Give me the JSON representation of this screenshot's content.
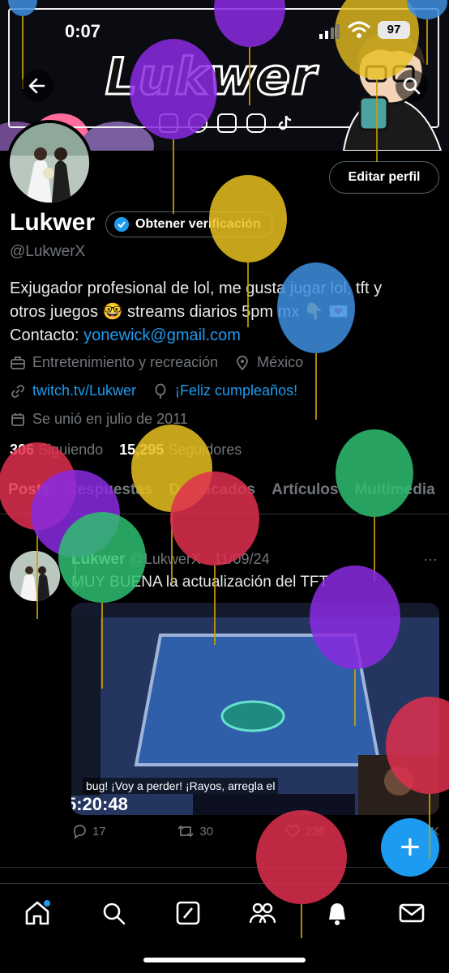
{
  "status": {
    "time": "0:07",
    "battery": "97"
  },
  "banner": {
    "logo_text": "Lukwer"
  },
  "profile": {
    "name": "Lukwer",
    "verify_label": "Obtener verificación",
    "handle": "@LukwerX",
    "edit_label": "Editar perfil",
    "bio_line1": "Exjugador profesional de lol, me gusta jugar lol, tft y",
    "bio_line2": "otros juegos 🤓 streams diarios 5pm mx 👇 💌",
    "bio_contact_label": "Contacto:",
    "bio_email": "yonewick@gmail.com",
    "category": "Entretenimiento y recreación",
    "location": "México",
    "website": "twitch.tv/Lukwer",
    "birthday": "¡Feliz cumpleaños!",
    "joined": "Se unió en julio de 2011",
    "following_count": "306",
    "following_label": "Siguiendo",
    "followers_count": "15,295",
    "followers_label": "Seguidores"
  },
  "tabs": [
    "Posts",
    "Respuestas",
    "Destacados",
    "Artículos",
    "Multimedia"
  ],
  "post": {
    "author": "Lukwer",
    "handle": "@LukwerX",
    "date": "11/09/24",
    "text": "MUY BUENA la actualización del TFT",
    "caption": "bug! ¡Voy a perder! ¡Rayos, arregla el",
    "video_time": "5:20:48",
    "replies": "17",
    "reposts": "30",
    "likes": "236",
    "views": "17K"
  },
  "colors": {
    "accent": "#1d9bf0",
    "muted": "#71767b",
    "background": "#000000"
  },
  "icons": [
    "back-arrow-icon",
    "search-icon",
    "verified-badge-icon",
    "briefcase-icon",
    "location-pin-icon",
    "link-icon",
    "balloon-icon",
    "calendar-icon",
    "reply-icon",
    "repost-icon",
    "like-icon",
    "views-icon",
    "home-icon",
    "explore-icon",
    "grok-icon",
    "communities-icon",
    "notifications-icon",
    "messages-icon"
  ]
}
